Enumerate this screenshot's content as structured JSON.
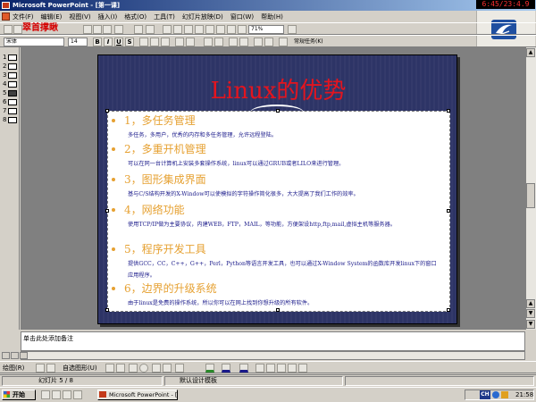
{
  "window": {
    "title": "Microsoft PowerPoint - [第一课]",
    "clock_overlay": "6:45/23:4.9"
  },
  "menu": [
    "文件(F)",
    "编辑(E)",
    "视图(V)",
    "插入(I)",
    "格式(O)",
    "工具(T)",
    "幻灯片放映(D)",
    "窗口(W)",
    "帮助(H)"
  ],
  "overlay_caption": "翠首撑瞅",
  "toolbar": {
    "zoom": "71%",
    "font_name": "宋体",
    "font_size": "14",
    "bold": "B",
    "italic": "I",
    "underline": "U",
    "shadow": "S",
    "common_tasks": "常规任务(K)"
  },
  "outline": {
    "slides": [
      "1",
      "2",
      "3",
      "4",
      "5",
      "6",
      "7",
      "8"
    ],
    "active_index": 4
  },
  "slide": {
    "title": "Linux的优势",
    "items": [
      {
        "head": "1，多任务管理",
        "desc": "多任务，多用户，优秀的内存和多任务管理，允许远程登陆。"
      },
      {
        "head": "2，多重开机管理",
        "desc": "可以在同一台计算机上安装多套操作系统，linux可以通过GRUB或者LILO来进行管理。"
      },
      {
        "head": "3，图形集成界面",
        "desc": "基与C/S结构开发的X-Window可以使模拟的字符操作简化很多，大大提高了我们工作的效率。"
      },
      {
        "head": "4，网络功能",
        "desc": "使用TCP/IP做为主要协议，内建WEB，FTP，MAIL，等功能，方便架设http,ftp,mail,虚拟主机等服务器。"
      },
      {
        "head": "5，程序开发工具",
        "desc": "提供GCC，CC，C++，G++，Perl，Python等语言开发工具，也可以通过X-Window System的函数库开发linux下的窗口应用程序。"
      },
      {
        "head": "6，边界的升级系统",
        "desc": "由于linux是免费的操作系统，所以你可以在网上找到你想升级的所有软件。"
      }
    ]
  },
  "notes_placeholder": "单击此处添加备注",
  "draw_toolbar": {
    "draw": "绘图(R)",
    "autoshapes": "自选图形(U)"
  },
  "status": {
    "slide_position": "幻灯片 5 / 8",
    "template": "默认设计模板"
  },
  "taskbar": {
    "start": "开始",
    "task": "Microsoft PowerPoint - [...",
    "ime": "CH",
    "time": "21:58"
  },
  "colors": {
    "title_red": "#e4141e",
    "bullet_orange": "#e6a132",
    "slide_navy": "#2d3466",
    "desc_blue": "#1a1a8a"
  }
}
